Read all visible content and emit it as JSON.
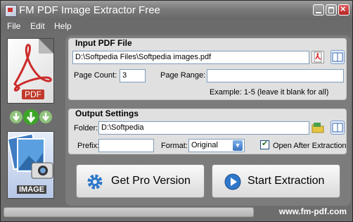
{
  "window": {
    "title": "FM PDF Image Extractor Free"
  },
  "menu": [
    "File",
    "Edit",
    "Help"
  ],
  "sidebar": {
    "pdf_label": "PDF",
    "image_label": "IMAGE"
  },
  "input": {
    "section_title": "Input PDF File",
    "file_path": "D:\\Softpedia Files\\Softpedia images.pdf",
    "page_count_label": "Page Count:",
    "page_count": "3",
    "page_range_label": "Page Range:",
    "page_range": "",
    "example": "Example: 1-5 (leave it blank for all)"
  },
  "output": {
    "section_title": "Output Settings",
    "folder_label": "Folder:",
    "folder": "D:\\Softpedia",
    "prefix_label": "Prefix:",
    "prefix": "",
    "format_label": "Format:",
    "format": "Original",
    "open_after_label": "Open After Extraction",
    "open_after_checked": true
  },
  "buttons": {
    "pro": "Get Pro Version",
    "start": "Start Extraction"
  },
  "status": {
    "website": "www.fm-pdf.com",
    "progress": 0
  }
}
